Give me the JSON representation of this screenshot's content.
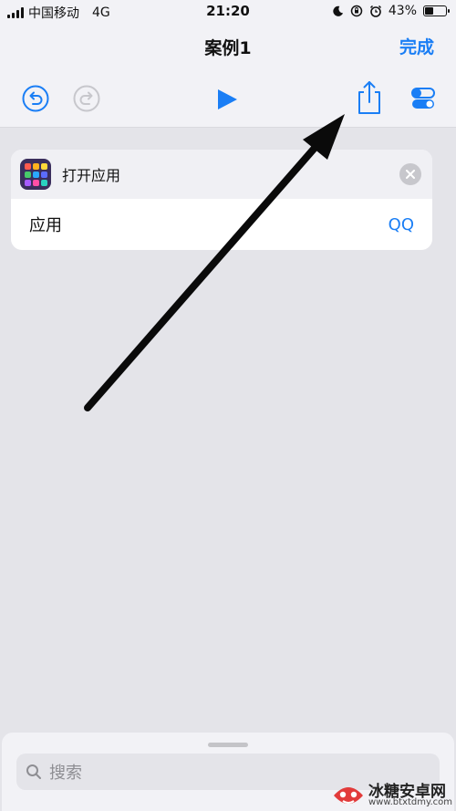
{
  "status_bar": {
    "carrier": "中国移动",
    "network": "4G",
    "time": "21:20",
    "battery_percent": "43%",
    "battery_level": 0.43,
    "icons": [
      "moon-icon",
      "rotation-lock-icon",
      "alarm-icon",
      "battery-icon"
    ]
  },
  "nav": {
    "title": "案例1",
    "done_label": "完成",
    "toolbar_icons": [
      "undo-icon",
      "redo-icon",
      "play-icon",
      "share-icon",
      "settings-toggle-icon"
    ]
  },
  "action": {
    "title": "打开应用",
    "param_label": "应用",
    "param_value": "QQ",
    "icon": "app-grid-icon"
  },
  "annotation": {
    "icon": "arrow-pointing-to-share"
  },
  "search": {
    "placeholder": "搜索",
    "icon": "search-icon"
  },
  "watermark": {
    "name": "冰糖安卓网",
    "url": "www.btxtdmy.com"
  },
  "colors": {
    "accent": "#1a7ef5",
    "background": "#e4e4e9",
    "bar": "#f2f2f6"
  }
}
